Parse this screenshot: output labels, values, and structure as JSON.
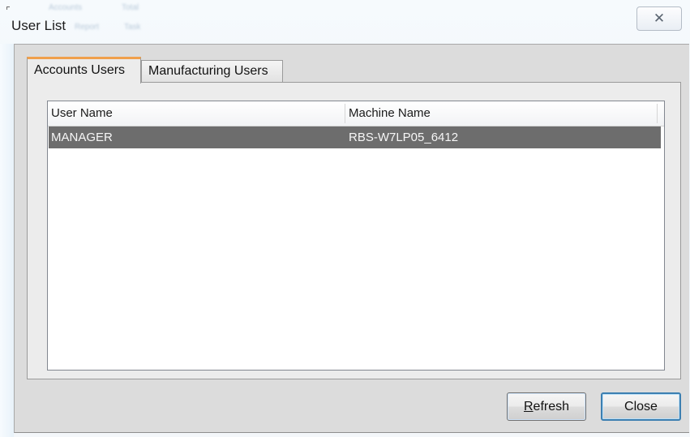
{
  "window": {
    "title": "User List",
    "close_glyph": "✕",
    "background_text": [
      "Accounts",
      "Total",
      "Report",
      "Task"
    ]
  },
  "tabs": [
    {
      "label": "Accounts Users",
      "active": true
    },
    {
      "label": "Manufacturing Users",
      "active": false
    }
  ],
  "list": {
    "columns": [
      "User Name",
      "Machine Name"
    ],
    "rows": [
      {
        "user_name": "MANAGER",
        "machine_name": "RBS-W7LP05_6412",
        "selected": true
      }
    ]
  },
  "buttons": {
    "refresh_accel": "R",
    "refresh_rest": "efresh",
    "close_label": "Close"
  },
  "colors": {
    "accent_tab": "#f0a04b",
    "selected_row": "#6d6d6d",
    "default_button_border": "#3c7fb1"
  },
  "icons": {
    "close": "close-icon"
  }
}
